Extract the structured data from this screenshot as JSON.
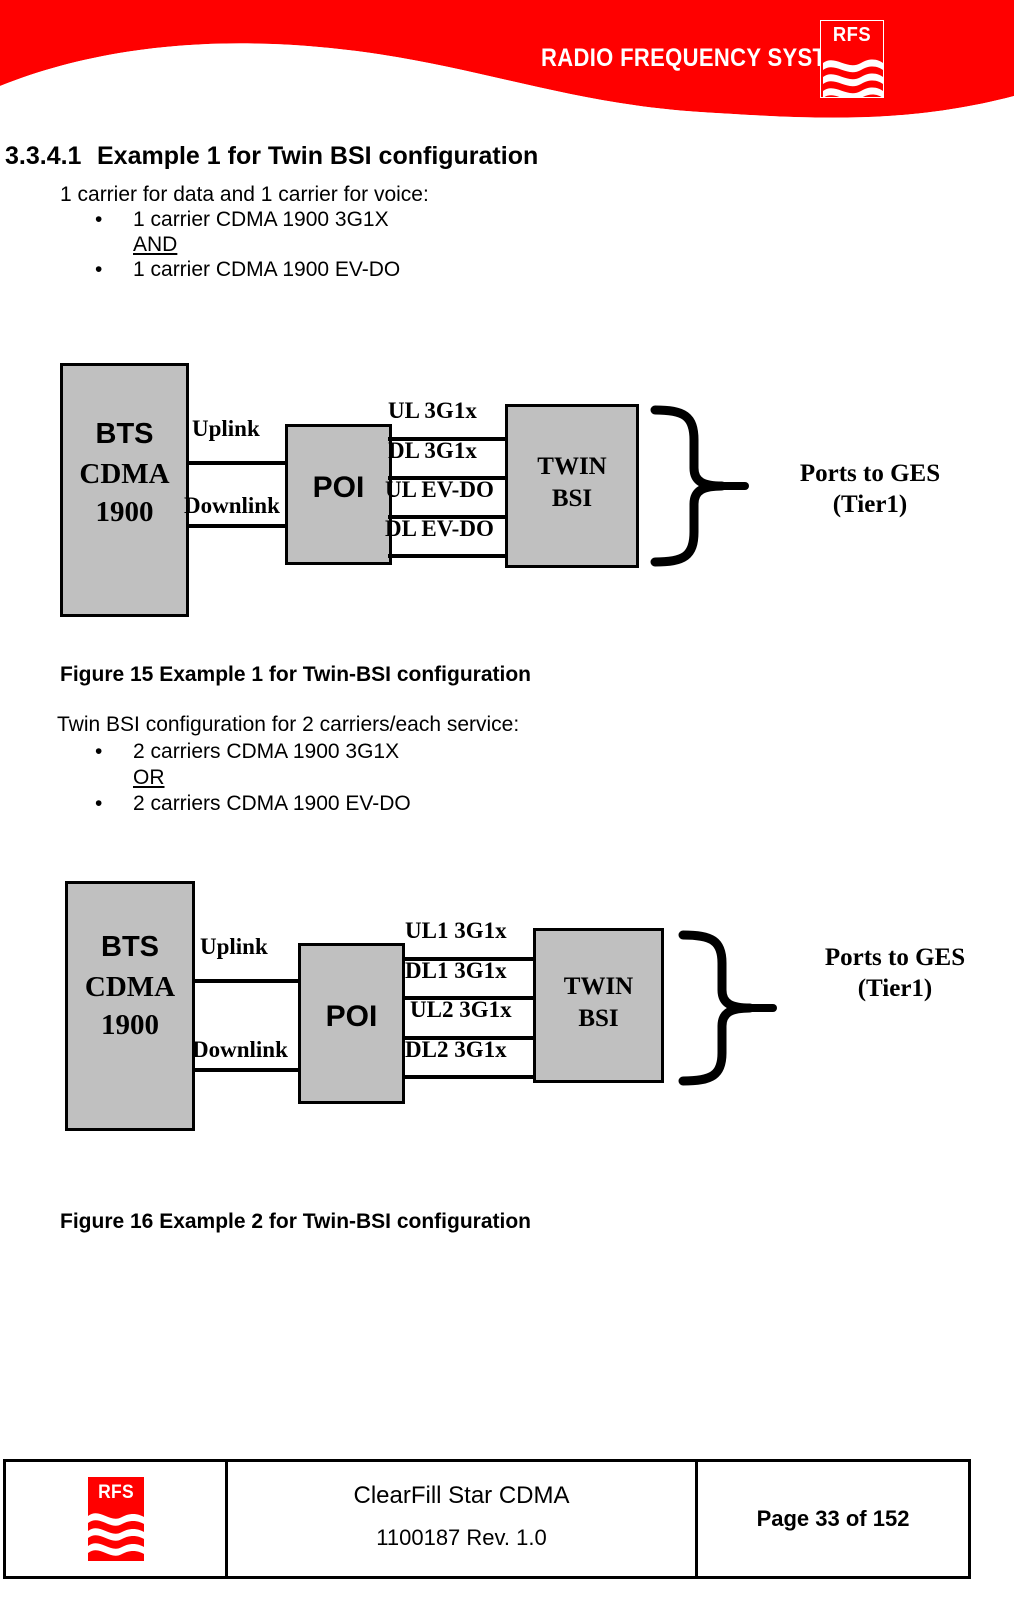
{
  "header": {
    "wordmark": "RADIO FREQUENCY SYSTEMS",
    "logo_text": "RFS",
    "brand_red": "#ff0000"
  },
  "section": {
    "number": "3.3.4.1",
    "title": "Example 1 for Twin BSI configuration"
  },
  "block1": {
    "intro": "1 carrier for data and 1 carrier for voice:",
    "bullet1": "1 carrier CDMA 1900 3G1X",
    "connector": "AND",
    "bullet2": "1 carrier CDMA 1900 EV-DO",
    "bullet_glyph": "•"
  },
  "figure15": {
    "caption": "Figure 15 Example 1 for Twin-BSI configuration",
    "bts": {
      "line1": "BTS",
      "line2": "CDMA",
      "line3": "1900"
    },
    "poi": "POI",
    "twin": {
      "line1": "TWIN",
      "line2": "BSI"
    },
    "uplink": "Uplink",
    "downlink": "Downlink",
    "ports": {
      "line1": "Ports to GES",
      "line2": "(Tier1)"
    },
    "links": [
      "UL 3G1x",
      "DL 3G1x",
      "UL EV-DO",
      "DL EV-DO"
    ],
    "box_fill": "#c0c0c0"
  },
  "block2": {
    "intro": "Twin BSI configuration for 2 carriers/each service:",
    "bullet1": "2 carriers CDMA 1900 3G1X",
    "connector": "OR ",
    "bullet2": "2 carriers CDMA 1900 EV-DO",
    "bullet_glyph": "•"
  },
  "figure16": {
    "caption": "Figure 16 Example 2 for Twin-BSI configuration",
    "bts": {
      "line1": "BTS",
      "line2": "CDMA",
      "line3": "1900"
    },
    "poi": "POI",
    "twin": {
      "line1": "TWIN",
      "line2": "BSI"
    },
    "uplink": "Uplink",
    "downlink": "Downlink",
    "ports": {
      "line1": "Ports to GES",
      "line2": "(Tier1)"
    },
    "links": [
      "UL1 3G1x",
      "DL1 3G1x",
      "UL2 3G1x",
      "DL2 3G1x"
    ],
    "box_fill": "#c0c0c0"
  },
  "footer": {
    "logo_text": "RFS",
    "doc_title": "ClearFill Star CDMA",
    "doc_number": "1100187 Rev. 1.0",
    "page_label": "Page 33 of 152"
  }
}
